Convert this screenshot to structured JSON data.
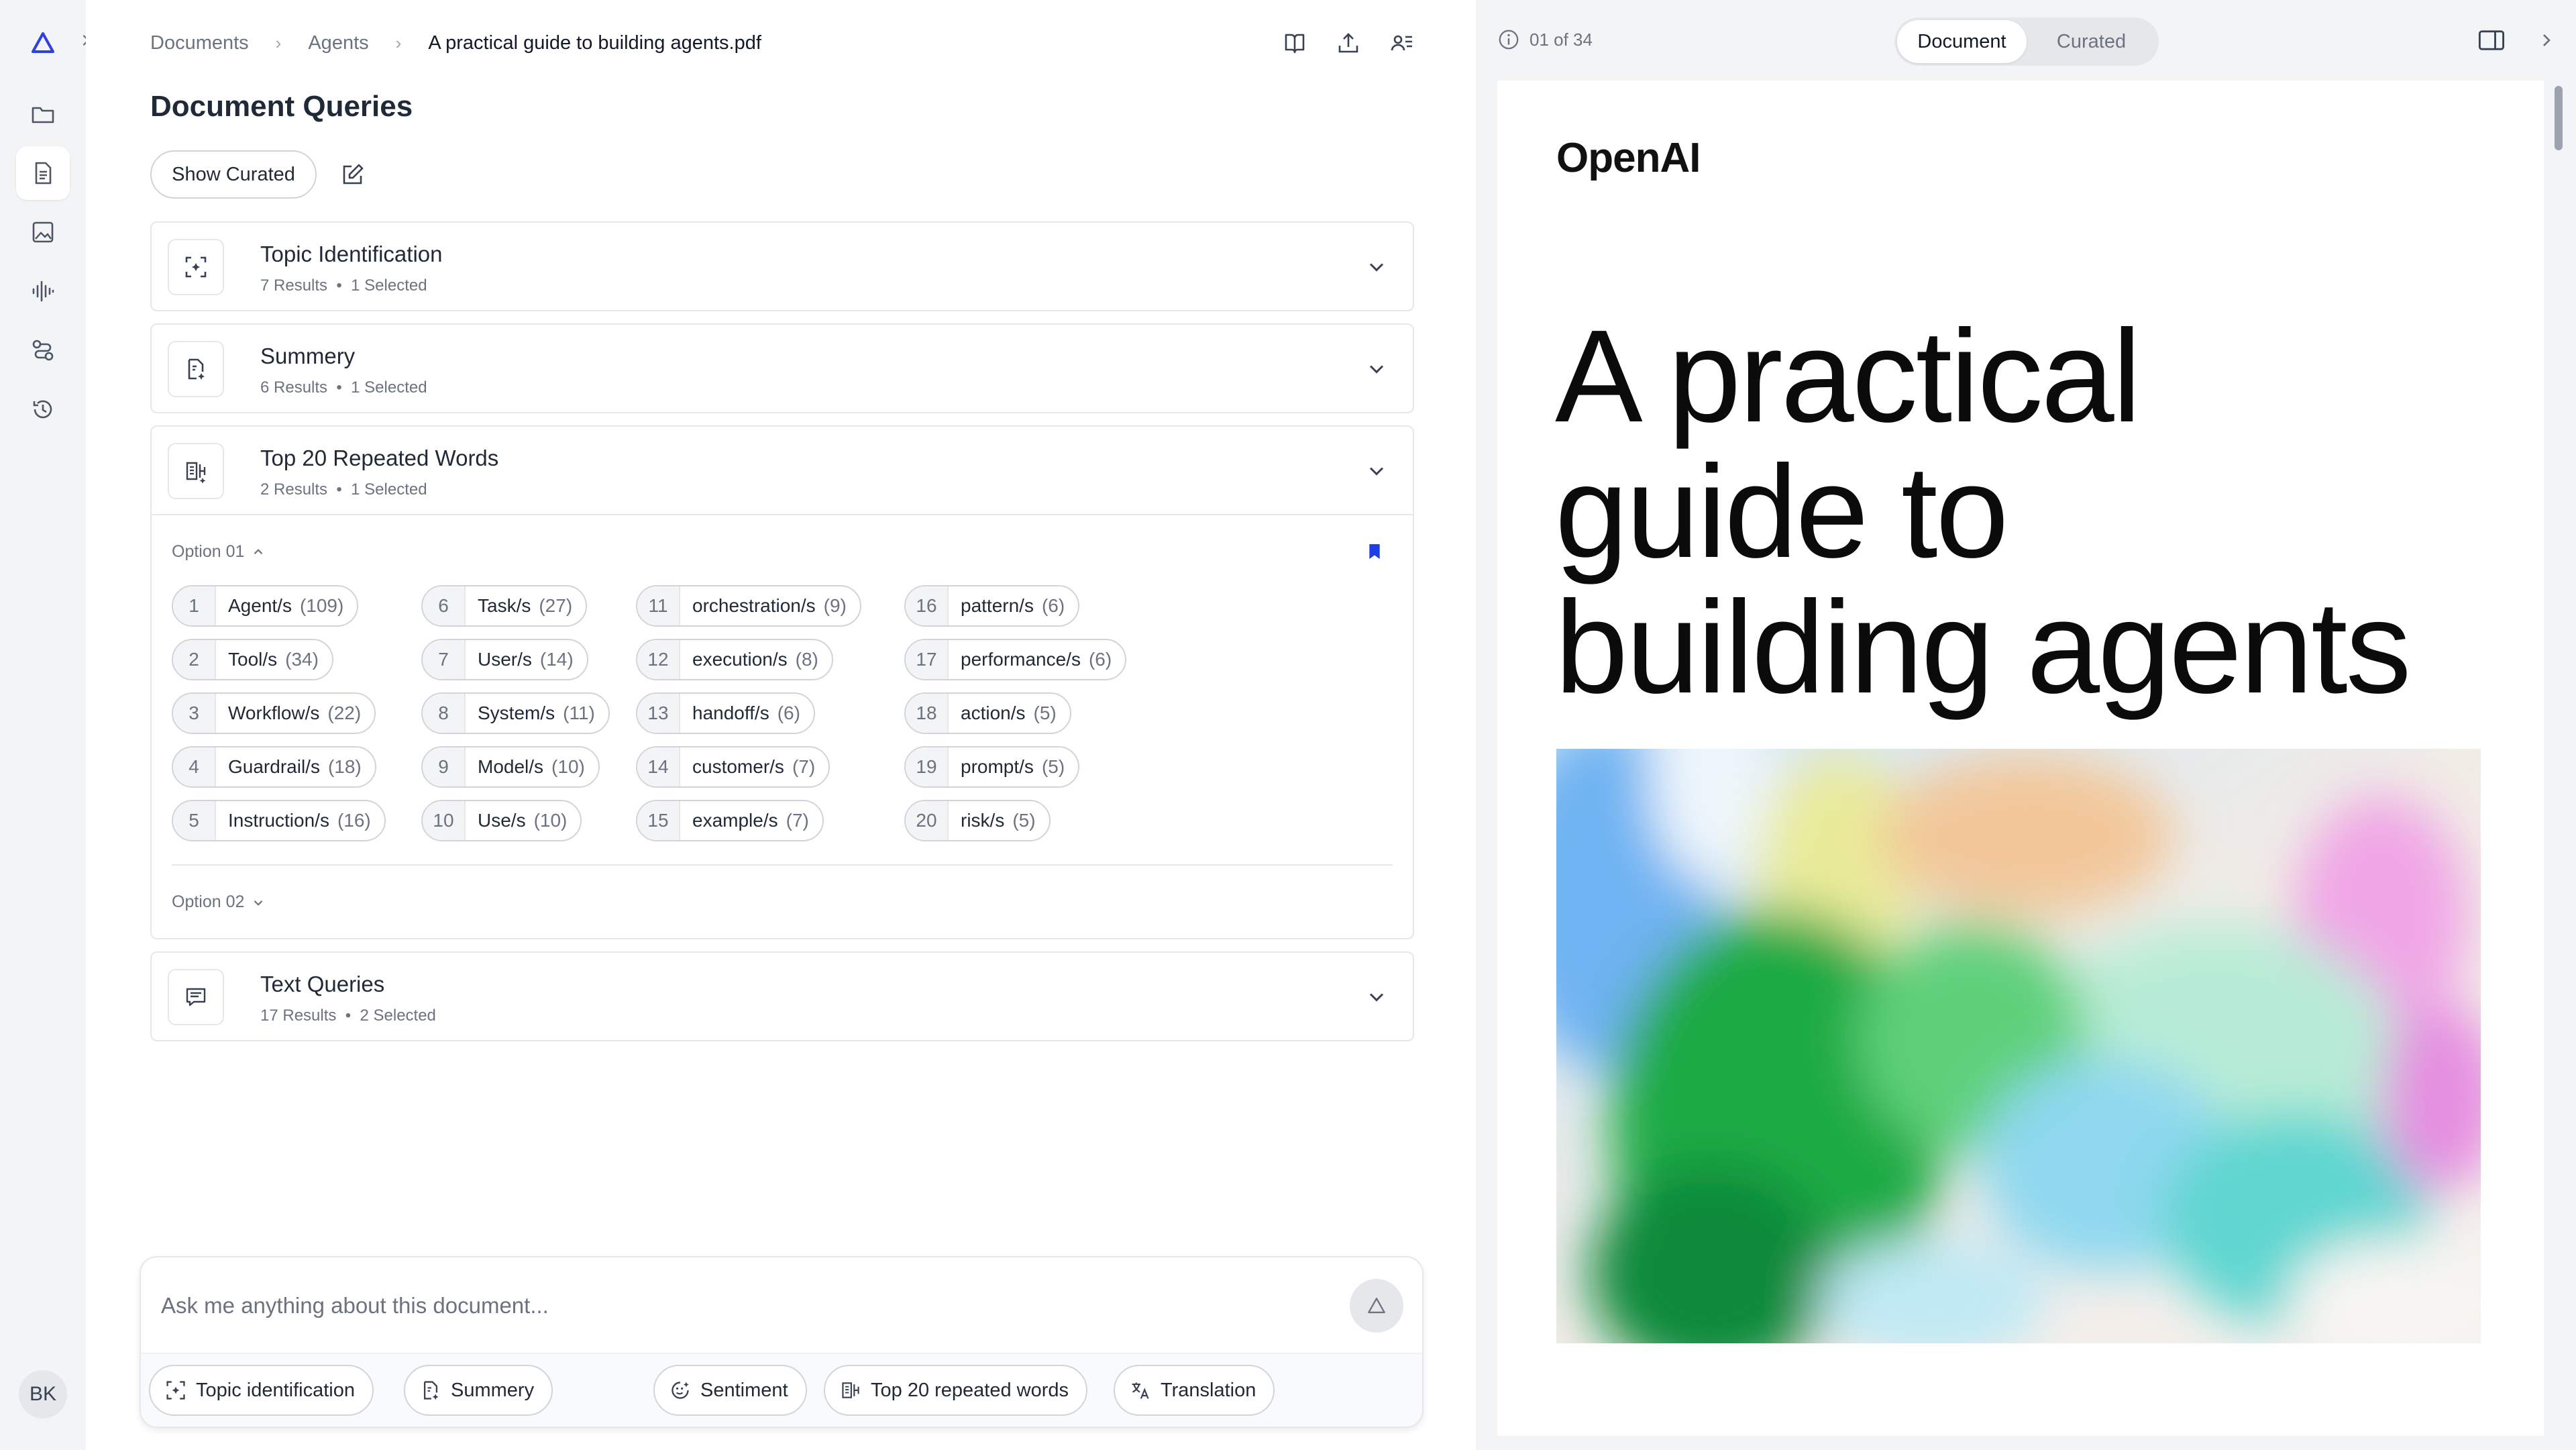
{
  "rail": {
    "items": [
      "logo-icon",
      "folder-icon",
      "document-icon",
      "image-icon",
      "audio-wave-icon",
      "workflow-icon",
      "history-icon"
    ],
    "avatar": "BK"
  },
  "breadcrumb": [
    "Documents",
    "Agents",
    "A practical guide to building agents.pdf"
  ],
  "page_title": "Document Queries",
  "show_curated_label": "Show Curated",
  "cards": [
    {
      "title": "Topic Identification",
      "results": "7 Results",
      "selected": "1 Selected"
    },
    {
      "title": "Summery",
      "results": "6 Results",
      "selected": "1 Selected"
    },
    {
      "title": "Top 20 Repeated Words",
      "results": "2 Results",
      "selected": "1 Selected"
    },
    {
      "title": "Text Queries",
      "results": "17 Results",
      "selected": "2 Selected"
    }
  ],
  "separator": "•",
  "options": {
    "option1": "Option 01",
    "option2": "Option 02"
  },
  "words": [
    {
      "n": "1",
      "w": "Agent/s",
      "c": "(109)"
    },
    {
      "n": "2",
      "w": "Tool/s",
      "c": "(34)"
    },
    {
      "n": "3",
      "w": "Workflow/s",
      "c": "(22)"
    },
    {
      "n": "4",
      "w": "Guardrail/s",
      "c": "(18)"
    },
    {
      "n": "5",
      "w": "Instruction/s",
      "c": "(16)"
    },
    {
      "n": "6",
      "w": "Task/s",
      "c": "(27)"
    },
    {
      "n": "7",
      "w": "User/s",
      "c": "(14)"
    },
    {
      "n": "8",
      "w": "System/s",
      "c": "(11)"
    },
    {
      "n": "9",
      "w": "Model/s",
      "c": "(10)"
    },
    {
      "n": "10",
      "w": "Use/s",
      "c": "(10)"
    },
    {
      "n": "11",
      "w": "orchestration/s",
      "c": "(9)"
    },
    {
      "n": "12",
      "w": "execution/s",
      "c": "(8)"
    },
    {
      "n": "13",
      "w": "handoff/s",
      "c": "(6)"
    },
    {
      "n": "14",
      "w": "customer/s",
      "c": "(7)"
    },
    {
      "n": "15",
      "w": "example/s",
      "c": "(7)"
    },
    {
      "n": "16",
      "w": "pattern/s",
      "c": "(6)"
    },
    {
      "n": "17",
      "w": "performance/s",
      "c": "(6)"
    },
    {
      "n": "18",
      "w": "action/s",
      "c": "(5)"
    },
    {
      "n": "19",
      "w": "prompt/s",
      "c": "(5)"
    },
    {
      "n": "20",
      "w": "risk/s",
      "c": "(5)"
    }
  ],
  "chat": {
    "placeholder": "Ask me anything about this document...",
    "chips": [
      "Topic identification",
      "Summery",
      "Sentiment",
      "Top 20 repeated words",
      "Translation"
    ]
  },
  "viewer": {
    "page_counter": "01 of 34",
    "tabs": [
      "Document",
      "Curated"
    ],
    "active_tab": "Document",
    "logo": "OpenAI",
    "title_lines": [
      "A practical",
      "guide to",
      "building agents"
    ]
  }
}
